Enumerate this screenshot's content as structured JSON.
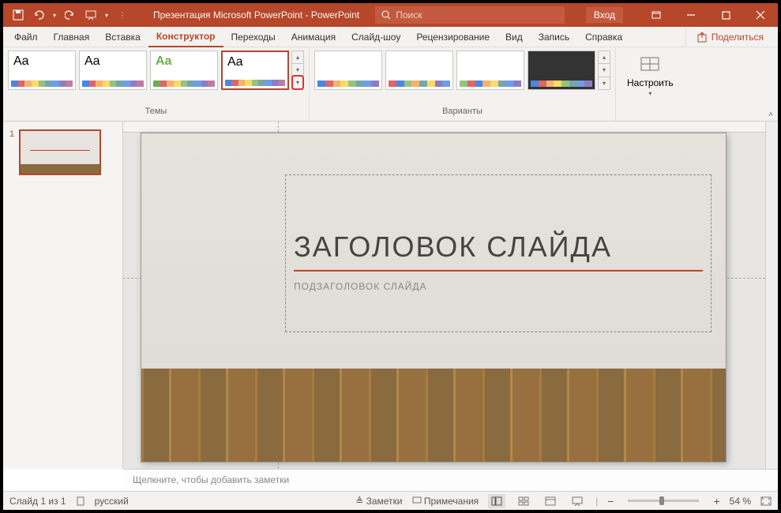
{
  "titlebar": {
    "title": "Презентация Microsoft PowerPoint - PowerPoint",
    "search_placeholder": "Поиск",
    "login": "Вход"
  },
  "tabs": {
    "file": "Файл",
    "home": "Главная",
    "insert": "Вставка",
    "design": "Конструктор",
    "transitions": "Переходы",
    "animation": "Анимация",
    "slideshow": "Слайд-шоу",
    "review": "Рецензирование",
    "view": "Вид",
    "record": "Запись",
    "help": "Справка",
    "share": "Поделиться"
  },
  "ribbon": {
    "themes_label": "Темы",
    "variants_label": "Варианты",
    "customize": "Настроить",
    "aa": "Aa"
  },
  "slide": {
    "number": "1",
    "title": "ЗАГОЛОВОК СЛАЙДА",
    "subtitle": "ПОДЗАГОЛОВОК СЛАЙДА"
  },
  "notes_placeholder": "Щелкните, чтобы добавить заметки",
  "status": {
    "slide_info": "Слайд 1 из 1",
    "language": "русский",
    "notes": "Заметки",
    "comments": "Примечания",
    "zoom": "54 %"
  },
  "colors": {
    "strip": [
      "#4a86e8",
      "#e06666",
      "#f6b26b",
      "#ffd966",
      "#93c47d",
      "#76a5af",
      "#6d9eeb",
      "#8e7cc3",
      "#c27ba0",
      "#999"
    ]
  }
}
